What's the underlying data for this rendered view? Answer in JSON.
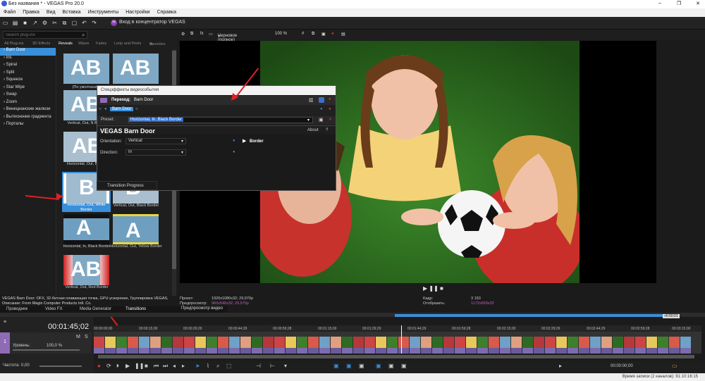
{
  "window": {
    "title": "Без названия * - VEGAS Pro 20.0",
    "controls": [
      "–",
      "❐",
      "✕"
    ]
  },
  "menu": [
    "Файл",
    "Правка",
    "Вид",
    "Вставка",
    "Инструменты",
    "Настройки",
    "Справка"
  ],
  "toolbar": {
    "hub_label": "Вход в концентратор VEGAS"
  },
  "plugins": {
    "search_placeholder": "Search plug-ins",
    "top_tabs": [
      "All Plug-ins",
      "3D Effects",
      "Reveals",
      "Wipes",
      "Fades",
      "Loop and Peels",
      "Favorites"
    ],
    "categories": [
      "Barn Door",
      "Iris",
      "Spiral",
      "Split",
      "Squeeze",
      "Star Wipe",
      "Swap",
      "Zoom",
      "Венецианские жалюзи",
      "Вытеснение градиента",
      "Порталы"
    ],
    "thumbs": [
      {
        "label": "(По умолчанию)",
        "letters": "AB"
      },
      {
        "label": "",
        "letters": "AB"
      },
      {
        "label": "Vertical, Out, N Border",
        "letters": "AB"
      },
      {
        "label": "",
        "letters": ""
      },
      {
        "label": "Horizontal, Out, Border",
        "letters": "AB"
      },
      {
        "label": "",
        "letters": ""
      },
      {
        "label": "Horizontal, Out, White Border",
        "letters": "B"
      },
      {
        "label": "Vertical, Out, Black Border",
        "letters": "B"
      },
      {
        "label": "Horizontal, In, Black Border",
        "letters": "A"
      },
      {
        "label": "Horizontal, Out, Yellow Border",
        "letters": "A"
      },
      {
        "label": "Vertical, Out, Red Border",
        "letters": "AB"
      }
    ],
    "description": "VEGAS Barn Door: OFX, 32-битная плавающая точка, GPU-ускорение, Группировка VEGAS, Описание: From Magix Computer Products Intl. Co."
  },
  "dock_tabs": [
    "Проводник",
    "Video FX",
    "Media Generator",
    "Transitions"
  ],
  "preview": {
    "quality": "Черновое (полное)",
    "zoom": "100 %",
    "tab_label": "Предпросмотр видео",
    "info": {
      "project_label": "Проект:",
      "project_value": "1920x1080x32; 29,970p",
      "preview_label": "Предпросмотр:",
      "preview_value": "960x540x32; 29,970p",
      "frame_label": "Кадр:",
      "frame_value": "3 150",
      "display_label": "Отобразить:",
      "display_value": "1172x659x32"
    }
  },
  "dialog": {
    "title": "Спецэффекты видеособытия",
    "transition_label": "Переход:",
    "transition_name": "Barn Door",
    "chain_badge": "Barn Door",
    "preset_label": "Preset:",
    "preset_value": "Horizontal, In, Black Border",
    "plugin_name": "VEGAS Barn Door",
    "about": "About",
    "help": "?",
    "orientation_label": "Orientation:",
    "orientation_value": "Vertical",
    "direction_label": "Direction:",
    "direction_value": "In",
    "border_label": "Border",
    "progress_label": "Transition Progress"
  },
  "timeline": {
    "timecode": "00:01:45;02",
    "track_number": "1",
    "level_label": "Уровень:",
    "level_value": "100,0 %",
    "rate_label": "Частота:",
    "rate_value": "0,00",
    "ruler_ticks": [
      "00:00:00;00",
      "00:00:15;00",
      "00:00:29;29",
      "00:00:44;29",
      "00:00:59;28",
      "00:01:15;00",
      "00:01:29;29",
      "00:01:44;29",
      "00:01:59;28",
      "00:02:15;00",
      "00:02:29;29",
      "00:02:44;29",
      "00:02:59;28",
      "00:03:15;00"
    ],
    "end_timecode": "00:00:00;00",
    "marker": "+6:50;01"
  },
  "status": {
    "text": "Время записи (2 каналов): 91:10:16:15"
  },
  "colors": {
    "accent": "#3a8fd9",
    "arrow": "#e02020",
    "track": "#8f6bb5"
  }
}
